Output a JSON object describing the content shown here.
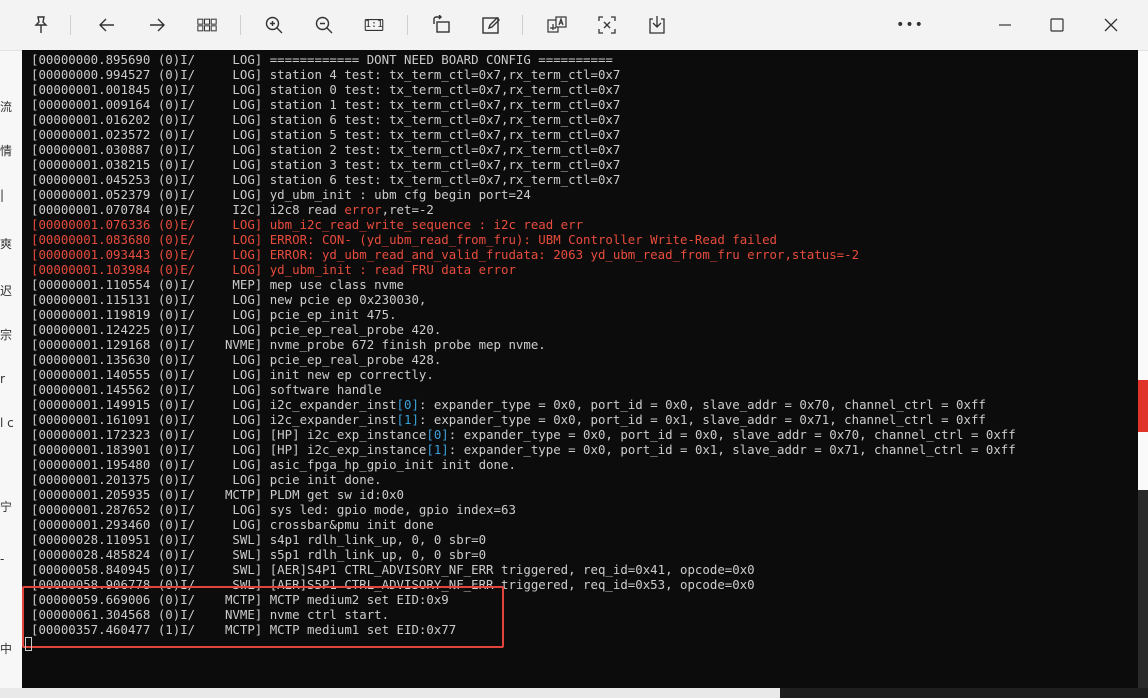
{
  "toolbar": {
    "buttons": [
      {
        "name": "pin-icon",
        "label": "Pin"
      },
      {
        "name": "back-arrow-icon",
        "label": "Back"
      },
      {
        "name": "forward-arrow-icon",
        "label": "Forward"
      },
      {
        "name": "grid-view-icon",
        "label": "Thumbnails"
      },
      {
        "name": "zoom-in-icon",
        "label": "Zoom in"
      },
      {
        "name": "zoom-out-icon",
        "label": "Zoom out"
      },
      {
        "name": "actual-size-icon",
        "label": "1:1"
      },
      {
        "name": "rotate-icon",
        "label": "Rotate"
      },
      {
        "name": "edit-icon",
        "label": "Edit"
      },
      {
        "name": "translate-icon",
        "label": "Translate"
      },
      {
        "name": "extract-text-icon",
        "label": "Extract text"
      },
      {
        "name": "save-icon",
        "label": "Save"
      },
      {
        "name": "more-icon",
        "label": "More"
      },
      {
        "name": "minimize-icon",
        "label": "Minimize"
      },
      {
        "name": "maximize-icon",
        "label": "Maximize"
      },
      {
        "name": "close-icon",
        "label": "Close"
      }
    ],
    "actual_size_text": "1:1",
    "more_text": "•••"
  },
  "colors": {
    "terminal_bg": "#0c0c0c",
    "text": "#cccccc",
    "error": "#e74c3c",
    "index_highlight": "#3aa0d8",
    "box": "#e0443a"
  },
  "background_left_chars": [
    "流",
    "情",
    "|",
    "爽",
    "迟",
    "宗",
    "r",
    "l c",
    "宁",
    "-",
    "中"
  ],
  "log_lines": [
    {
      "ts": "[00000000.895690 (0)I/",
      "tag": "     LOG]",
      "msg": " ============ DONT NEED BOARD CONFIG ==========",
      "kind": "normal"
    },
    {
      "ts": "[00000000.994527 (0)I/",
      "tag": "     LOG]",
      "msg": " station 4 test: tx_term_ctl=0x7,rx_term_ctl=0x7",
      "kind": "normal"
    },
    {
      "ts": "[00000001.001845 (0)I/",
      "tag": "     LOG]",
      "msg": " station 0 test: tx_term_ctl=0x7,rx_term_ctl=0x7",
      "kind": "normal"
    },
    {
      "ts": "[00000001.009164 (0)I/",
      "tag": "     LOG]",
      "msg": " station 1 test: tx_term_ctl=0x7,rx_term_ctl=0x7",
      "kind": "normal"
    },
    {
      "ts": "[00000001.016202 (0)I/",
      "tag": "     LOG]",
      "msg": " station 6 test: tx_term_ctl=0x7,rx_term_ctl=0x7",
      "kind": "normal"
    },
    {
      "ts": "[00000001.023572 (0)I/",
      "tag": "     LOG]",
      "msg": " station 5 test: tx_term_ctl=0x7,rx_term_ctl=0x7",
      "kind": "normal"
    },
    {
      "ts": "[00000001.030887 (0)I/",
      "tag": "     LOG]",
      "msg": " station 2 test: tx_term_ctl=0x7,rx_term_ctl=0x7",
      "kind": "normal"
    },
    {
      "ts": "[00000001.038215 (0)I/",
      "tag": "     LOG]",
      "msg": " station 3 test: tx_term_ctl=0x7,rx_term_ctl=0x7",
      "kind": "normal"
    },
    {
      "ts": "[00000001.045253 (0)I/",
      "tag": "     LOG]",
      "msg": " station 6 test: tx_term_ctl=0x7,rx_term_ctl=0x7",
      "kind": "normal"
    },
    {
      "ts": "[00000001.052379 (0)I/",
      "tag": "     LOG]",
      "msg": " yd_ubm_init : ubm cfg begin port=24",
      "kind": "normal"
    },
    {
      "ts": "[00000001.070784 (0)E/",
      "tag": "     I2C]",
      "msg": " i2c8 read ",
      "msg2": "error",
      "msg3": ",ret=-2",
      "kind": "partial"
    },
    {
      "ts": "[00000001.076336 (0)E/",
      "tag": "     LOG]",
      "msg": " ubm_i2c_read_write_sequence : i2c read err",
      "kind": "error"
    },
    {
      "ts": "[00000001.083680 (0)E/",
      "tag": "     LOG]",
      "msg": " ERROR: CON- (yd_ubm_read_from_fru): UBM Controller Write-Read failed",
      "kind": "error"
    },
    {
      "ts": "[00000001.093443 (0)E/",
      "tag": "     LOG]",
      "msg": " ERROR: yd_ubm_read_and_valid_frudata: 2063 yd_ubm_read_from_fru error,status=-2",
      "kind": "error"
    },
    {
      "ts": "[00000001.103984 (0)E/",
      "tag": "     LOG]",
      "msg": " yd_ubm_init : read FRU data error",
      "kind": "error"
    },
    {
      "ts": "[00000001.110554 (0)I/",
      "tag": "     MEP]",
      "msg": " mep use class nvme",
      "kind": "normal"
    },
    {
      "ts": "[00000001.115131 (0)I/",
      "tag": "     LOG]",
      "msg": " new pcie ep 0x230030,",
      "kind": "normal"
    },
    {
      "ts": "[00000001.119819 (0)I/",
      "tag": "     LOG]",
      "msg": " pcie_ep_init 475.",
      "kind": "normal"
    },
    {
      "ts": "[00000001.124225 (0)I/",
      "tag": "     LOG]",
      "msg": " pcie_ep_real_probe 420.",
      "kind": "normal"
    },
    {
      "ts": "[00000001.129168 (0)I/",
      "tag": "    NVME]",
      "msg": " nvme_probe 672 finish probe mep nvme.",
      "kind": "normal"
    },
    {
      "ts": "[00000001.135630 (0)I/",
      "tag": "     LOG]",
      "msg": " pcie_ep_real_probe 428.",
      "kind": "normal"
    },
    {
      "ts": "[00000001.140555 (0)I/",
      "tag": "     LOG]",
      "msg": " init new ep correctly.",
      "kind": "normal"
    },
    {
      "ts": "[00000001.145562 (0)I/",
      "tag": "     LOG]",
      "msg": " software handle",
      "kind": "normal"
    },
    {
      "ts": "[00000001.149915 (0)I/",
      "tag": "     LOG]",
      "msg": " i2c_expander_inst",
      "idx": "[0]",
      "msg3": ": expander_type = 0x0, port_id = 0x0, slave_addr = 0x70, channel_ctrl = 0xff",
      "kind": "indexed"
    },
    {
      "ts": "[00000001.161091 (0)I/",
      "tag": "     LOG]",
      "msg": " i2c_expander_inst",
      "idx": "[1]",
      "msg3": ": expander_type = 0x0, port_id = 0x1, slave_addr = 0x71, channel_ctrl = 0xff",
      "kind": "indexed"
    },
    {
      "ts": "[00000001.172323 (0)I/",
      "tag": "     LOG]",
      "msg": " [HP] i2c_exp_instance",
      "idx": "[0]",
      "msg3": ": expander_type = 0x0, port_id = 0x0, slave_addr = 0x70, channel_ctrl = 0xff",
      "kind": "indexed"
    },
    {
      "ts": "[00000001.183901 (0)I/",
      "tag": "     LOG]",
      "msg": " [HP] i2c_exp_instance",
      "idx": "[1]",
      "msg3": ": expander_type = 0x0, port_id = 0x1, slave_addr = 0x71, channel_ctrl = 0xff",
      "kind": "indexed"
    },
    {
      "ts": "[00000001.195480 (0)I/",
      "tag": "     LOG]",
      "msg": " asic_fpga_hp_gpio_init init done.",
      "kind": "normal"
    },
    {
      "ts": "[00000001.201375 (0)I/",
      "tag": "     LOG]",
      "msg": " pcie init done.",
      "kind": "normal"
    },
    {
      "ts": "[00000001.205935 (0)I/",
      "tag": "    MCTP]",
      "msg": " PLDM get sw id:0x0",
      "kind": "normal"
    },
    {
      "ts": "[00000001.287652 (0)I/",
      "tag": "     LOG]",
      "msg": " sys led: gpio mode, gpio index=63",
      "kind": "normal"
    },
    {
      "ts": "[00000001.293460 (0)I/",
      "tag": "     LOG]",
      "msg": " crossbar&pmu init done",
      "kind": "normal"
    },
    {
      "ts": "[00000028.110951 (0)I/",
      "tag": "     SWL]",
      "msg": " s4p1 rdlh_link_up, 0, 0 sbr=0",
      "kind": "normal"
    },
    {
      "ts": "[00000028.485824 (0)I/",
      "tag": "     SWL]",
      "msg": " s5p1 rdlh_link_up, 0, 0 sbr=0",
      "kind": "normal"
    },
    {
      "ts": "[00000058.840945 (0)I/",
      "tag": "     SWL]",
      "msg": " [AER]S4P1 CTRL_ADVISORY_NF_ERR triggered, req_id=0x41, opcode=0x0",
      "kind": "normal"
    },
    {
      "ts": "[00000058.906778 (0)I/",
      "tag": "     SWL]",
      "msg": " [AER]S5P1 CTRL_ADVISORY_NF_ERR triggered, req_id=0x53, opcode=0x0",
      "kind": "normal"
    },
    {
      "ts": "[00000059.669006 (0)I/",
      "tag": "    MCTP]",
      "msg": " MCTP medium2 set EID:0x9",
      "kind": "normal"
    },
    {
      "ts": "[00000061.304568 (0)I/",
      "tag": "    NVME]",
      "msg": " nvme ctrl start.",
      "kind": "normal"
    },
    {
      "ts": "[00000357.460477 (1)I/",
      "tag": "    MCTP]",
      "msg": " MCTP medium1 set EID:0x77",
      "kind": "normal"
    }
  ]
}
